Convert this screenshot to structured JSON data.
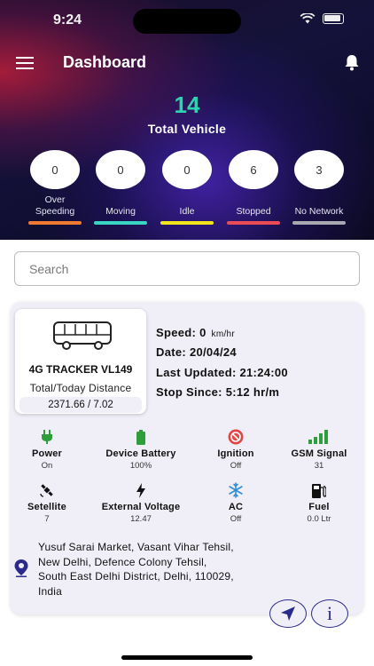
{
  "status_bar": {
    "time": "9:24"
  },
  "header": {
    "title": "Dashboard"
  },
  "summary": {
    "total": "14",
    "label": "Total Vehicle"
  },
  "stats": [
    {
      "count": "0",
      "label": "Over Speeding",
      "color": "#f07a30"
    },
    {
      "count": "0",
      "label": "Moving",
      "color": "#38d6c2"
    },
    {
      "count": "0",
      "label": "Idle",
      "color": "#f2e61a"
    },
    {
      "count": "6",
      "label": "Stopped",
      "color": "#ea4b55"
    },
    {
      "count": "3",
      "label": "No Network",
      "color": "#a8a8b0"
    }
  ],
  "search": {
    "placeholder": "Search"
  },
  "vehicle": {
    "name": "4G TRACKER VL149",
    "distance_label": "Total/Today Distance",
    "distance_value": "2371.66 / 7.02",
    "speed_label": "Speed:",
    "speed_value": "0",
    "speed_unit": "km/hr",
    "date_label": "Date:",
    "date_value": "20/04/24",
    "updated_label": "Last Updated:",
    "updated_value": "21:24:00",
    "stop_label": "Stop Since:",
    "stop_value": "5:12 hr/m",
    "indicators": [
      {
        "name": "Power",
        "value": "On",
        "icon": "plug-icon",
        "color": "#2e9e3a"
      },
      {
        "name": "Device Battery",
        "value": "100%",
        "icon": "battery-icon",
        "color": "#2e9e3a"
      },
      {
        "name": "Ignition",
        "value": "Off",
        "icon": "ignition-icon",
        "color": "#e04848"
      },
      {
        "name": "GSM Signal",
        "value": "31",
        "icon": "signal-icon",
        "color": "#2e9e3a"
      },
      {
        "name": "Setellite",
        "value": "7",
        "icon": "satellite-icon",
        "color": "#111111"
      },
      {
        "name": "External Voltage",
        "value": "12.47",
        "icon": "bolt-icon",
        "color": "#111111"
      },
      {
        "name": "AC",
        "value": "Off",
        "icon": "snowflake-icon",
        "color": "#2f8fd8"
      },
      {
        "name": "Fuel",
        "value": "0.0 Ltr",
        "icon": "fuel-icon",
        "color": "#111111"
      }
    ],
    "address_lines": [
      "Yusuf Sarai Market, Vasant Vihar Tehsil,",
      "New Delhi, Defence Colony Tehsil,",
      "South East Delhi District, Delhi, 110029,",
      "India"
    ],
    "info_button": "i"
  }
}
